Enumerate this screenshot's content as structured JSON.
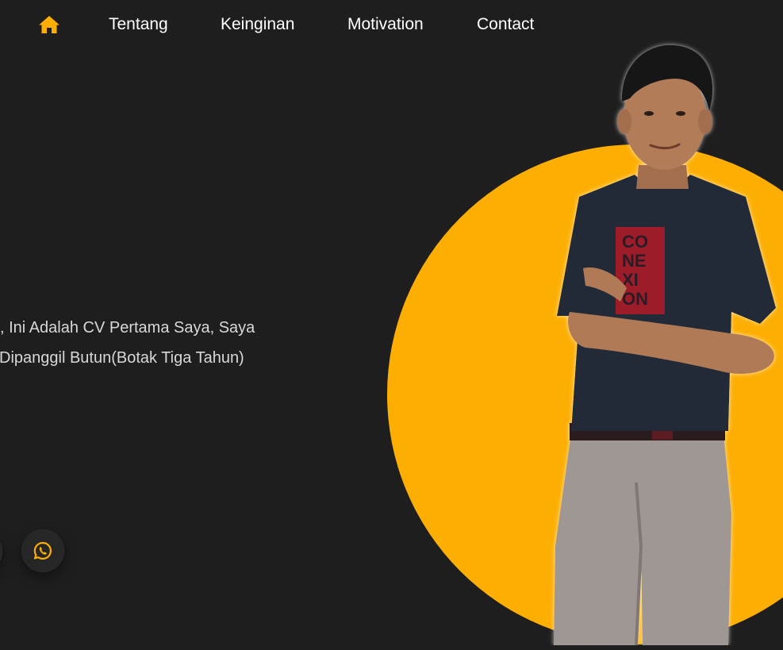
{
  "nav": {
    "home_icon": "home-icon",
    "links": [
      "Tentang",
      "Keinginan",
      "Motivation",
      "Contact"
    ]
  },
  "intro": {
    "line1": ", Ini Adalah CV Pertama Saya, Saya",
    "line2": "Dipanggil Butun(Botak Tiga Tahun)"
  },
  "social": {
    "icons": [
      "social-icon",
      "whatsapp-icon"
    ]
  },
  "hero": {
    "shirt_text": [
      "CO",
      "NE",
      "XI",
      "ON"
    ]
  },
  "colors": {
    "background": "#1e1e1f",
    "accent": "#fdae03",
    "text": "#ffffff",
    "muted_text": "#d8d8d8"
  }
}
